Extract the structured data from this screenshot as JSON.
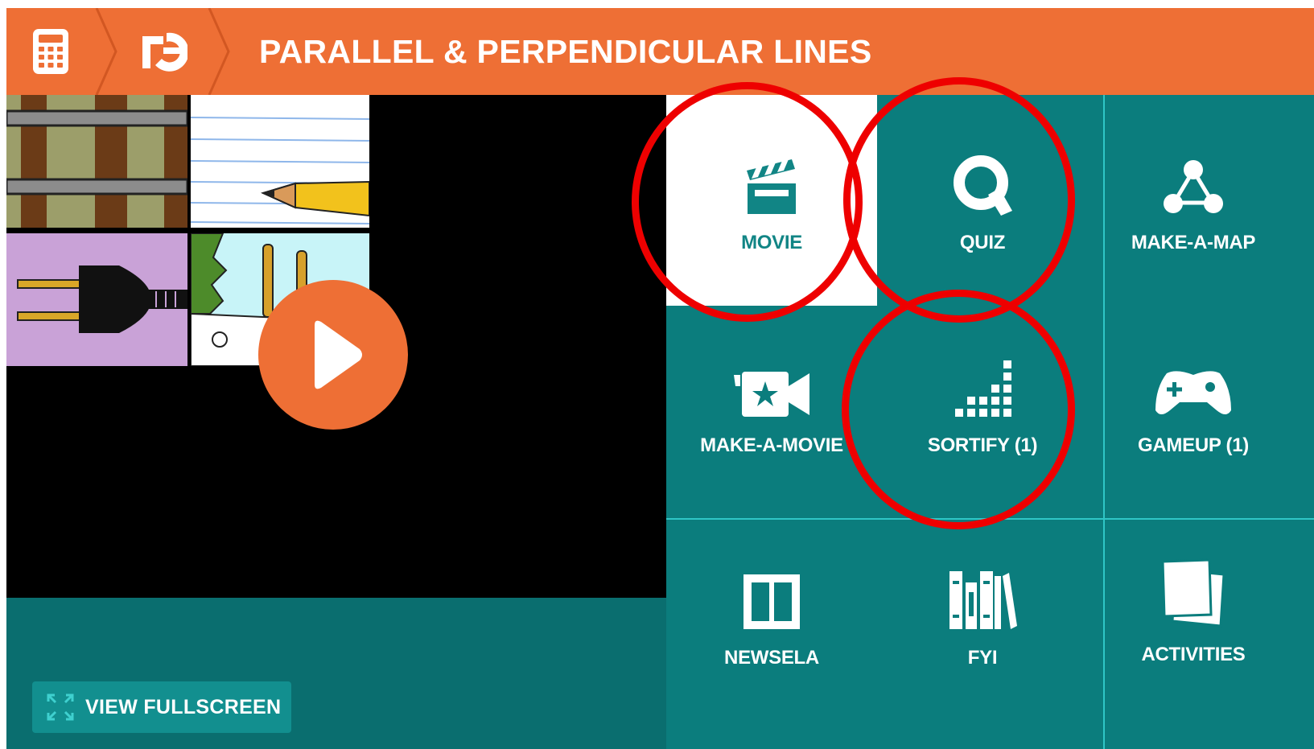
{
  "header": {
    "title": "PARALLEL & PERPENDICULAR LINES",
    "color": "#ee6f35"
  },
  "player": {
    "fullscreen_label": "VIEW FULLSCREEN"
  },
  "tiles": [
    {
      "label": "MOVIE",
      "icon": "clapperboard-icon",
      "active": true
    },
    {
      "label": "QUIZ",
      "icon": "quiz-q-icon"
    },
    {
      "label": "MAKE-A-MAP",
      "icon": "concept-map-icon"
    },
    {
      "label": "MAKE-A-MOVIE",
      "icon": "video-camera-star-icon"
    },
    {
      "label": "SORTIFY (1)",
      "icon": "sortify-dots-icon"
    },
    {
      "label": "GAMEUP (1)",
      "icon": "gamepad-icon"
    },
    {
      "label": "NEWSELA",
      "icon": "newsela-book-icon"
    },
    {
      "label": "FYI",
      "icon": "books-icon"
    },
    {
      "label": "ACTIVITIES",
      "icon": "activity-cards-icon"
    }
  ],
  "colors": {
    "accent": "#ee6f35",
    "teal": "#0b7d7d",
    "highlight_ring": "#ee0000"
  }
}
